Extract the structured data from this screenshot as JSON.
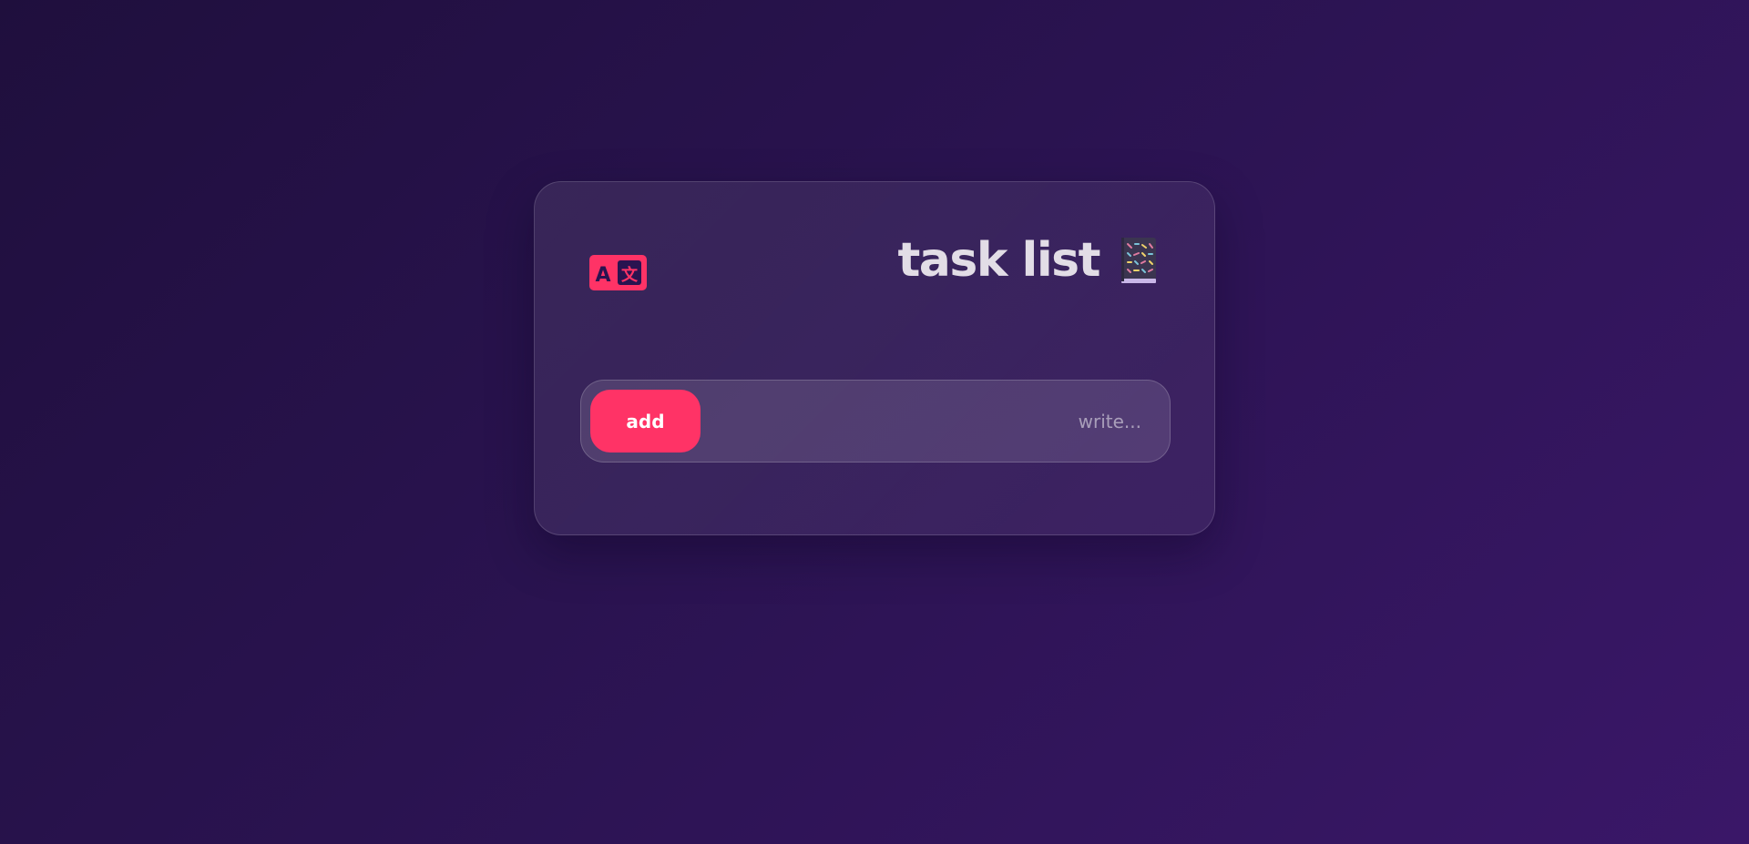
{
  "app": {
    "title": "task list",
    "title_icon": "notebook-icon"
  },
  "toolbar": {
    "language_icon": "translate-icon"
  },
  "task_form": {
    "add_label": "add",
    "input_value": "",
    "input_placeholder": "...write"
  },
  "colors": {
    "accent": "#ff3366",
    "title_text": "#e2dde6",
    "background_start": "#1f0f3d",
    "background_end": "#3a1768"
  }
}
